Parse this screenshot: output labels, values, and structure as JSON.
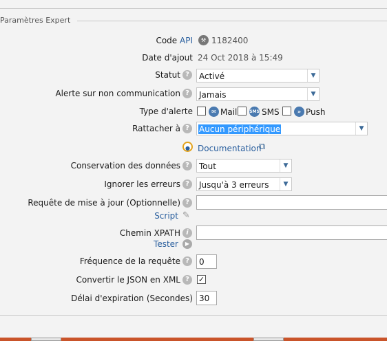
{
  "section": {
    "legend": "Paramètres Expert"
  },
  "fields": {
    "code_api": {
      "label_prefix": "Code",
      "label_link": "API",
      "value": "1182400"
    },
    "date_ajout": {
      "label": "Date d'ajout",
      "value": "24 Oct 2018 à 15:49"
    },
    "statut": {
      "label": "Statut",
      "value": "Activé"
    },
    "alerte": {
      "label": "Alerte sur non communication",
      "value": "Jamais"
    },
    "type_alerte": {
      "label": "Type d'alerte",
      "mail": "Mail",
      "sms": "SMS",
      "push": "Push",
      "sms_badge": "SMS"
    },
    "rattacher": {
      "label": "Rattacher à",
      "value": "Aucun périphérique"
    },
    "documentation": {
      "label": "Documentation"
    },
    "conservation": {
      "label": "Conservation des données",
      "value": "Tout"
    },
    "ignorer": {
      "label": "Ignorer les erreurs",
      "value": "Jusqu'à 3 erreurs"
    },
    "requete": {
      "label": "Requête de mise à jour (Optionnelle)",
      "script_link": "Script",
      "value": ""
    },
    "xpath": {
      "label": "Chemin XPATH",
      "tester_link": "Tester",
      "value": ""
    },
    "frequence": {
      "label": "Fréquence de la requête",
      "value": "0"
    },
    "json_xml": {
      "label": "Convertir le JSON en XML",
      "checked": true
    },
    "delai": {
      "label": "Délai d'expiration (Secondes)",
      "value": "30"
    }
  },
  "icons": {
    "help": "?",
    "info": "i"
  },
  "colors": {
    "link": "#2a5f9e",
    "selection": "#3399ff",
    "footer": "#c9542a"
  }
}
